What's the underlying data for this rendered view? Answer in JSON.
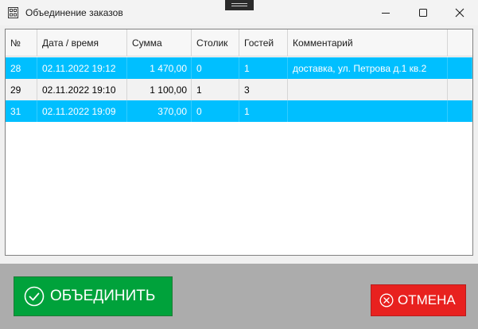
{
  "window": {
    "title": "Объединение заказов"
  },
  "grid": {
    "columns": [
      "№",
      "Дата / время",
      "Сумма",
      "Столик",
      "Гостей",
      "Комментарий",
      ""
    ],
    "rows": [
      {
        "num": "28",
        "datetime": "02.11.2022 19:12",
        "sum": "1 470,00",
        "table": "0",
        "guests": "1",
        "comment": "доставка, ул. Петрова д.1 кв.2",
        "selected": true
      },
      {
        "num": "29",
        "datetime": "02.11.2022 19:10",
        "sum": "1 100,00",
        "table": "1",
        "guests": "3",
        "comment": "",
        "selected": false
      },
      {
        "num": "31",
        "datetime": "02.11.2022 19:09",
        "sum": "370,00",
        "table": "0",
        "guests": "1",
        "comment": "",
        "selected": true
      }
    ]
  },
  "actions": {
    "merge_label": "ОБЪЕДИНИТЬ",
    "cancel_label": "ОТМЕНА"
  },
  "colors": {
    "selection": "#00bfff",
    "merge": "#00a23b",
    "cancel": "#e8211f"
  }
}
